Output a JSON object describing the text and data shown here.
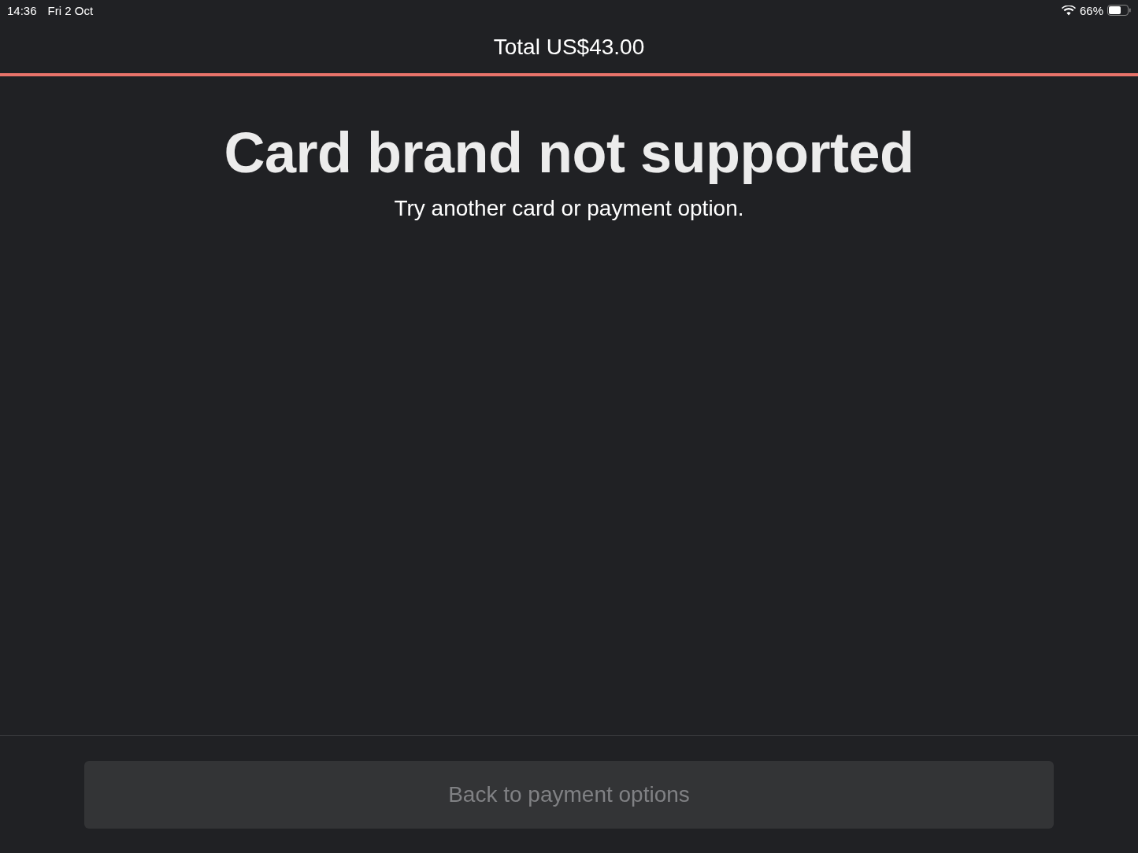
{
  "status_bar": {
    "time": "14:36",
    "date": "Fri 2 Oct",
    "battery": "66%"
  },
  "header": {
    "title": "Total US$43.00"
  },
  "message": {
    "title": "Card brand not supported",
    "subtitle": "Try another card or payment option."
  },
  "button": {
    "label": "Back to payment options",
    "disabled": true
  }
}
